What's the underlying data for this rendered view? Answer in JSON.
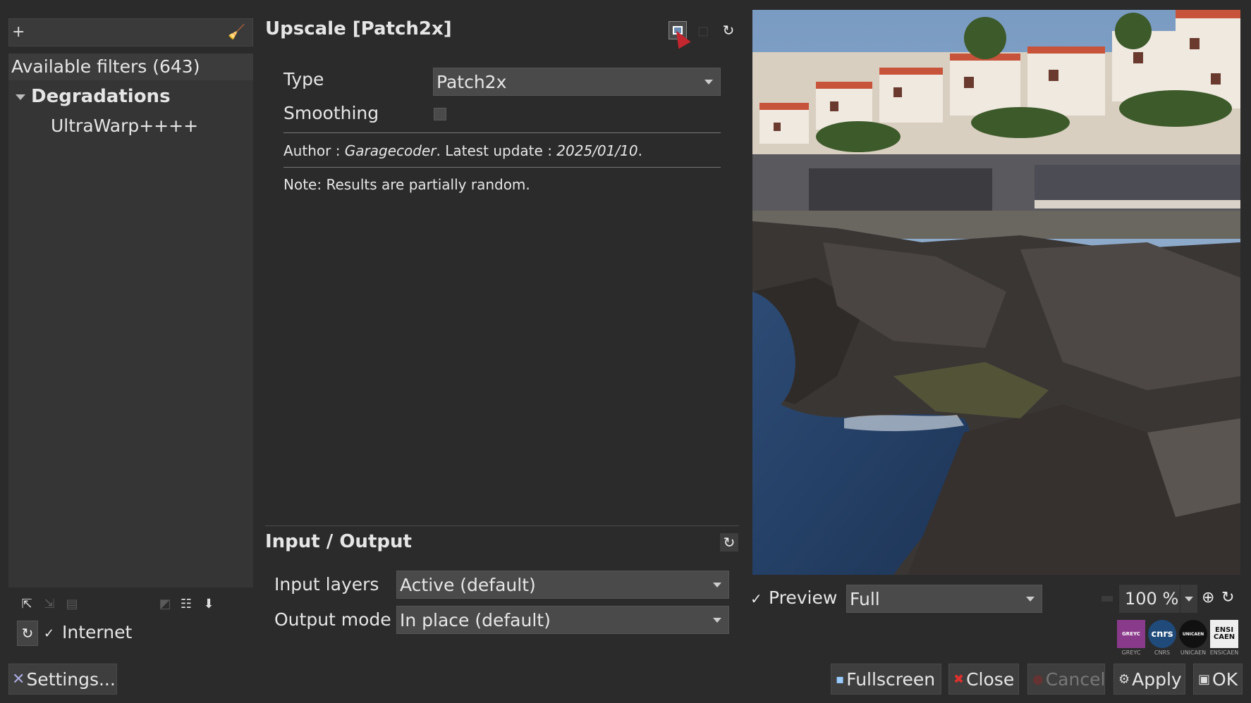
{
  "filter_panel": {
    "search_plus": "+",
    "header": "Available filters (643)",
    "category": "Degradations",
    "items": [
      "UltraWarp++++"
    ],
    "internet_label": "Internet",
    "settings_label": "Settings..."
  },
  "filter": {
    "title": "Upscale [Patch2x]",
    "params": {
      "type_label": "Type",
      "type_value": "Patch2x",
      "smoothing_label": "Smoothing",
      "smoothing_checked": false
    },
    "author_prefix": "Author : ",
    "author_name": "Garagecoder",
    "update_prefix": ". Latest update : ",
    "update_date": "2025/01/10",
    "update_suffix": ".",
    "note": "Note: Results are partially random."
  },
  "io": {
    "title": "Input / Output",
    "input_label": "Input layers",
    "input_value": "Active (default)",
    "output_label": "Output mode",
    "output_value": "In place (default)"
  },
  "preview": {
    "checked": true,
    "label": "Preview",
    "mode": "Full",
    "zoom": "100 %"
  },
  "logos": [
    {
      "name": "GREYC",
      "caption": "GREYC"
    },
    {
      "name": "cnrs",
      "caption": "CNRS"
    },
    {
      "name": "UNICAEN",
      "caption": "UNICAEN"
    },
    {
      "name": "ENSI CAEN",
      "caption": "ENSICAEN"
    }
  ],
  "buttons": {
    "fullscreen": "Fullscreen",
    "close": "Close",
    "cancel": "Cancel",
    "apply": "Apply",
    "ok": "OK"
  }
}
